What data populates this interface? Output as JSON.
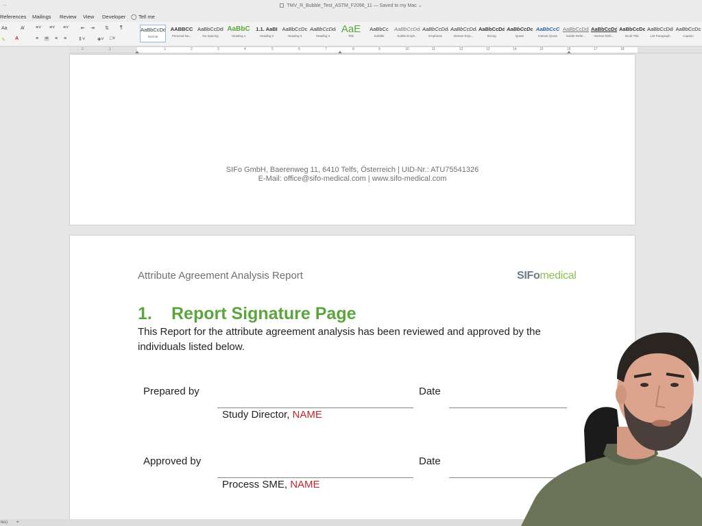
{
  "window": {
    "dots": "...",
    "document_title": "TMV_R_Bubble_Test_ASTM_F2096_11 — Saved to my Mac ⌄"
  },
  "menu": {
    "tabs": [
      "References",
      "Mailings",
      "Review",
      "View",
      "Developer"
    ],
    "tell_me": "Tell me"
  },
  "ribbon": {
    "font_size_icon": "Aa",
    "clear_format_icon": "A̸",
    "highlight_icon": "✎",
    "font_color_icon": "A",
    "pilcrow": "¶",
    "sort_icon": "⇅"
  },
  "styles": [
    {
      "sample": "AaBbCcDdEe",
      "name": "Normal"
    },
    {
      "sample": "AABBCC",
      "name": "Personal Na..."
    },
    {
      "sample": "AaBbCcDdEe",
      "name": "No Spacing"
    },
    {
      "sample": "AaBbC",
      "name": "Heading 1"
    },
    {
      "sample": "1.1. AaBI",
      "name": "Heading 2"
    },
    {
      "sample": "AaBbCcDc",
      "name": "Heading 3"
    },
    {
      "sample": "AaBbCcDdE",
      "name": "Heading 4"
    },
    {
      "sample": "AaE",
      "name": "Title"
    },
    {
      "sample": "AaBbCc",
      "name": "Subtitle"
    },
    {
      "sample": "AaBbCcDdEe",
      "name": "Subtle Emph..."
    },
    {
      "sample": "AaBbCcDdEe",
      "name": "Emphasis"
    },
    {
      "sample": "AaBbCcDdE",
      "name": "Intense Emp..."
    },
    {
      "sample": "AaBbCcDdE",
      "name": "Strong"
    },
    {
      "sample": "AaBbCcDc",
      "name": "Quote"
    },
    {
      "sample": "AaBbCcC",
      "name": "Intense Quote"
    },
    {
      "sample": "AaBbCcDdE",
      "name": "Subtle Refer..."
    },
    {
      "sample": "AaBbCcDd",
      "name": "Intense Refe..."
    },
    {
      "sample": "AaBbCcDc",
      "name": "Book Title"
    },
    {
      "sample": "AaBbCcDdEe",
      "name": "List Paragraph"
    },
    {
      "sample": "AaBbCcDc",
      "name": "Caption"
    }
  ],
  "ruler": {
    "numbers": [
      "2",
      "1",
      "1",
      "2",
      "3",
      "4",
      "5",
      "6",
      "7",
      "8",
      "9",
      "10",
      "11",
      "12",
      "13",
      "14",
      "15",
      "16",
      "17",
      "18"
    ]
  },
  "page1": {
    "footer_line1": "SIFo GmbH, Baerenweg 11, 6410 Telfs, Österreich | UID-Nr.: ATU75541326",
    "footer_line2": "E-Mail: office@sifo-medical.com | www.sifo-medical.com"
  },
  "page2": {
    "header_title": "Attribute Agreement Analysis Report",
    "logo_part1": "SIFo",
    "logo_part2": "medical",
    "heading_number": "1.",
    "heading_text": "Report Signature Page",
    "body": "This Report for the attribute agreement analysis has been reviewed and approved by the individuals listed below.",
    "prepared_label": "Prepared by",
    "date_label_1": "Date",
    "prepared_role": "Study Director, ",
    "prepared_name": "NAME",
    "approved_label": "Approved by",
    "date_label_2": "Date",
    "approved_role": "Process SME, ",
    "approved_name": "NAME"
  },
  "statusbar": {
    "left_text": "tes)"
  },
  "colors": {
    "heading_green": "#5ba53e",
    "placeholder_red": "#c0262d",
    "logo_gray": "#6b7a86",
    "logo_green": "#8cc152"
  }
}
